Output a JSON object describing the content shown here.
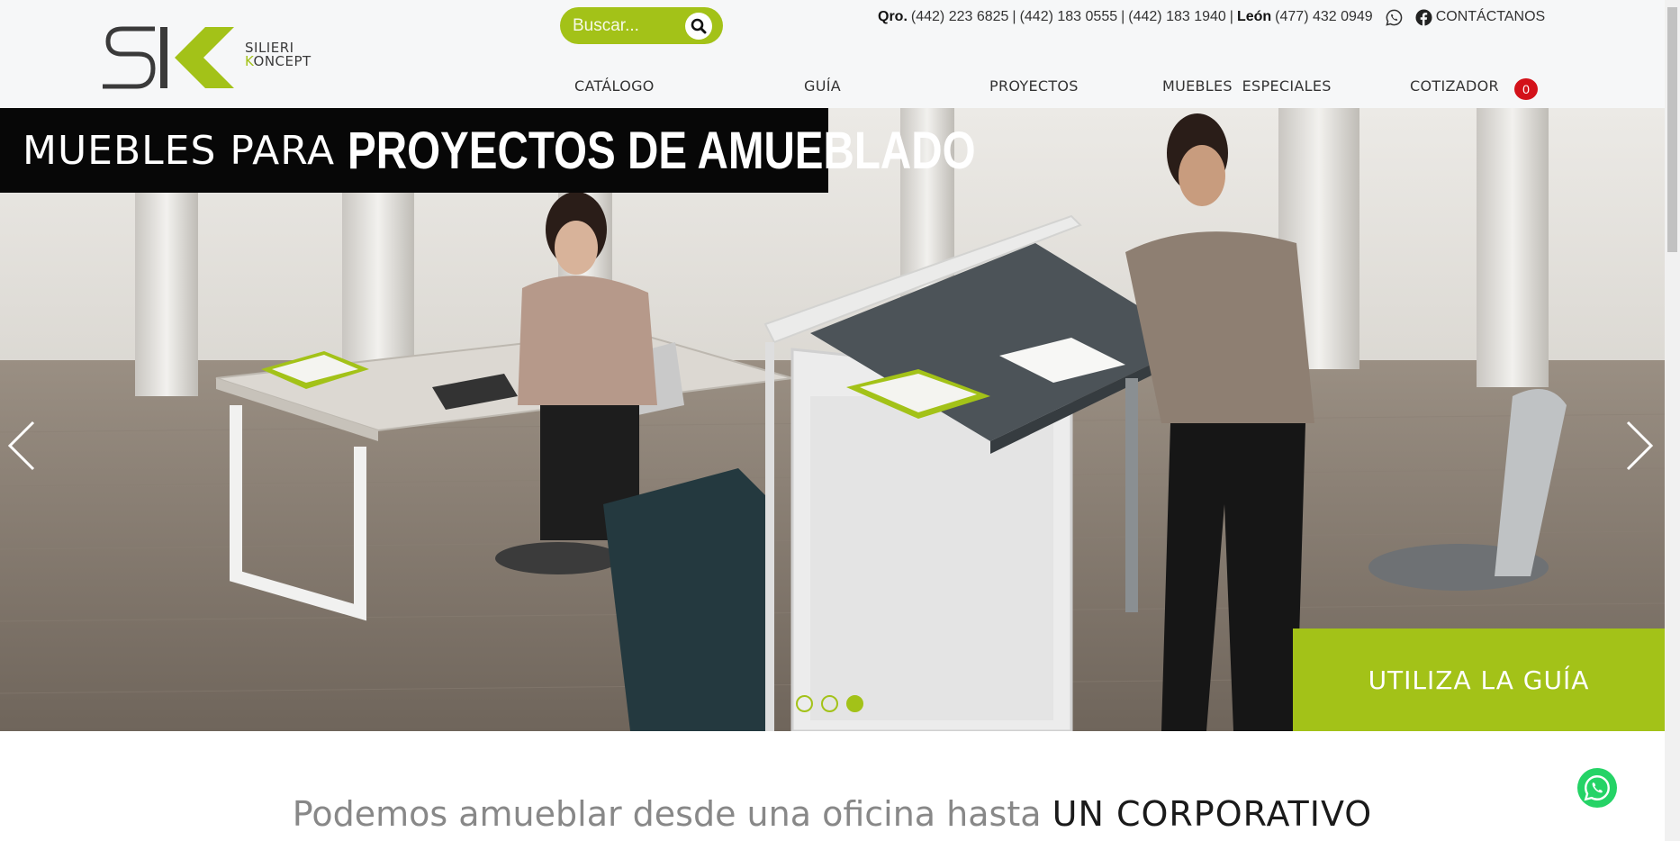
{
  "header": {
    "logo": {
      "mark": "SK",
      "line1": "SILIERI",
      "line2_k": "K",
      "line2_rest": "ONCEPT"
    },
    "search": {
      "placeholder": "Buscar..."
    },
    "contact": {
      "qro_label": "Qro.",
      "qro_phone1": "(442) 223 6825",
      "qro_phone2": "(442) 183 0555",
      "qro_phone3": "(442) 183 1940",
      "leon_label": "León",
      "leon_phone": "(477) 432 0949",
      "separator": "|",
      "contact_link": "CONTÁCTANOS"
    },
    "nav": {
      "catalogo": "CATÁLOGO",
      "guia": "GUÍA",
      "proyectos": "PROYECTOS",
      "muebles_especiales": "MUEBLES  ESPECIALES",
      "cotizador": "COTIZADOR",
      "cart_count": "0"
    }
  },
  "hero": {
    "title_light": "MUEBLES PARA",
    "title_bold": "PROYECTOS DE AMUEBLADO",
    "cta": "UTILIZA LA GUÍA",
    "slides": 3,
    "active_slide": 3
  },
  "section": {
    "heading_light": "Podemos amueblar desde una oficina hasta",
    "heading_strong": "UN CORPORATIVO"
  },
  "colors": {
    "accent_green": "#a3c218",
    "cart_badge_red": "#d3121a",
    "whatsapp_green": "#25d366",
    "header_bg": "#f6f7f8"
  },
  "icons": {
    "search": "search-icon",
    "whatsapp": "whatsapp-icon",
    "facebook": "facebook-icon",
    "prev": "chevron-left-icon",
    "next": "chevron-right-icon"
  }
}
